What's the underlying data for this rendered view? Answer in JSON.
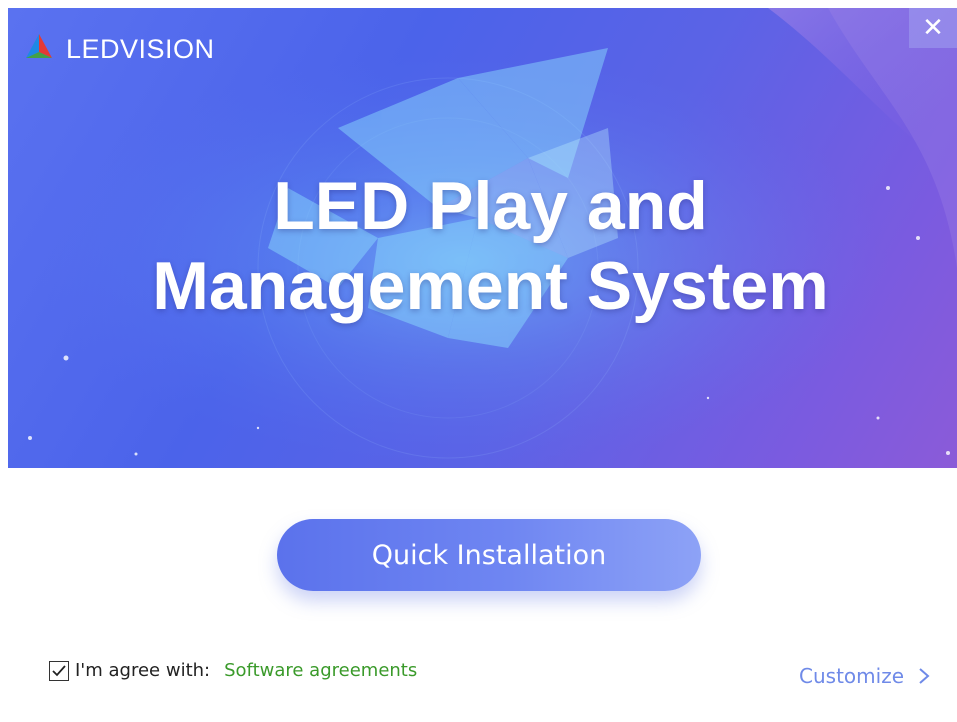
{
  "app": {
    "logo_text": "LEDVISION",
    "headline_line1": "LED Play and",
    "headline_line2": "Management System"
  },
  "window_controls": {
    "close_glyph": "✕"
  },
  "actions": {
    "install_label": "Quick Installation",
    "customize_label": "Customize"
  },
  "agreement": {
    "checked": true,
    "label": "I'm agree with:",
    "link_text": "Software agreements"
  },
  "colors": {
    "banner_primary": "#4b63ea",
    "banner_secondary": "#8b5bd8",
    "install_button": "#6f86f2",
    "link_green": "#3a9a2a",
    "customize_blue": "#6f8ae8"
  },
  "icons": {
    "logo": "ledvision-logo-icon",
    "close": "close-icon",
    "checkbox": "checkmark-icon",
    "customize": "chevron-right-icon"
  }
}
